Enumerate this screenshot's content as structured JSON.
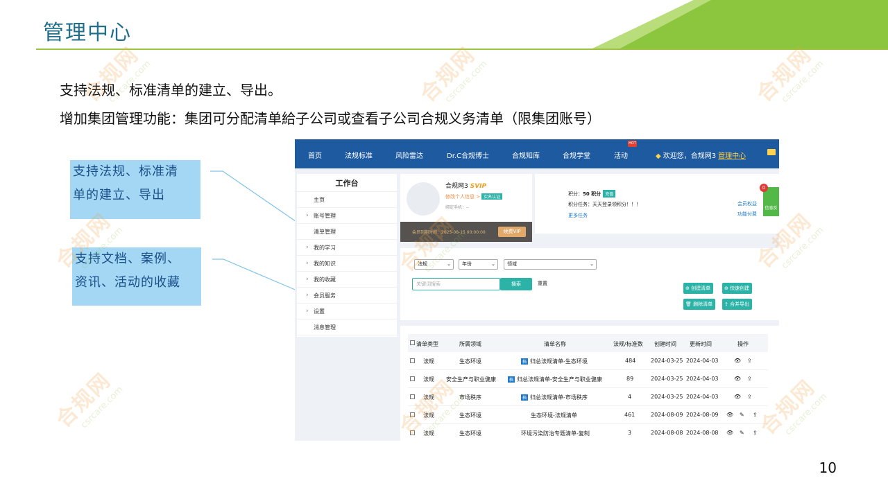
{
  "slide": {
    "title": "管理中心",
    "bullets": [
      "支持法规、标准清单的建立、导出。",
      "增加集团管理功能：集团可分配清单給子公司或查看子公司合规义务清单（限集团账号）"
    ],
    "callouts": [
      [
        "支持法规、标准清",
        "单的建立、导出"
      ],
      [
        "支持文档、案例、",
        "资讯、活动的收藏"
      ]
    ],
    "page_number": "10",
    "watermark": {
      "cn": "合规网",
      "en": "csrcare.com"
    },
    "colors": {
      "title": "#1f6f8b",
      "rule": "#9bc53d",
      "callout_bg": "#a3d7f3",
      "nav": "#1e5aa0",
      "teal": "#2bb3a8"
    }
  },
  "app": {
    "nav": {
      "items": [
        "首页",
        "法规标准",
        "风险雷达",
        "Dr.C合规博士",
        "合规知库",
        "合规学堂",
        "活动"
      ],
      "hot_badge": "HOT",
      "welcome": "欢迎您，合规网3",
      "admin_link": "管理中心"
    },
    "sidebar": {
      "title": "工作台",
      "items": [
        "主页",
        "账号管理",
        "清单管理",
        "我的学习",
        "我的知识",
        "我的收藏",
        "会员服务",
        "设置",
        "消息管理"
      ]
    },
    "profile": {
      "name": "合规网3",
      "level": "SVIP",
      "edit_link": "修改个人信息 >",
      "verified": "实名认证",
      "phone": "绑定手机：--",
      "expiry": "会员到期时间：2025-08-15 00:00:00",
      "renew": "续费VIP"
    },
    "points": {
      "label": "积分：",
      "value": "50 积分",
      "recharge": "充值",
      "task": "积分任务：天天登录领积分！！！",
      "more_tasks": "更多任务",
      "member_rights": "会员权益",
      "paid_features": "功能付费",
      "notifications": "0",
      "info_button": "信息反"
    },
    "filters": {
      "selects": [
        "法规",
        "年份",
        "领域"
      ],
      "keyword_placeholder": "关键词搜索",
      "search": "搜索",
      "reset": "重置",
      "actions": [
        "创建清单",
        "快速创建",
        "删除清单",
        "合并导出"
      ]
    },
    "table": {
      "headers": [
        "清单类型",
        "所属领域",
        "清单名称",
        "法规/标准数",
        "创建时间",
        "更新时间",
        "操作"
      ],
      "rows": [
        {
          "type": "法规",
          "field": "生态环境",
          "tag": "档",
          "name": "归总法规清单-生态环境",
          "count": "484",
          "created": "2024-03-25",
          "updated": "2024-04-03"
        },
        {
          "type": "法规",
          "field": "安全生产与职业健康",
          "tag": "档",
          "name": "归总法规清单-安全生产与职业健康",
          "count": "89",
          "created": "2024-03-25",
          "updated": "2024-04-03"
        },
        {
          "type": "法规",
          "field": "市场秩序",
          "tag": "档",
          "name": "归总法规清单-市场秩序",
          "count": "4",
          "created": "2024-03-25",
          "updated": "2024-04-03"
        },
        {
          "type": "法规",
          "field": "生态环境",
          "tag": "",
          "name": "生态环境-法规清单",
          "count": "461",
          "created": "2024-08-09",
          "updated": "2024-08-09"
        },
        {
          "type": "法规",
          "field": "生态环境",
          "tag": "",
          "name": "环境污染防治专题清单-复制",
          "count": "3",
          "created": "2024-08-08",
          "updated": "2024-08-08"
        }
      ]
    }
  }
}
